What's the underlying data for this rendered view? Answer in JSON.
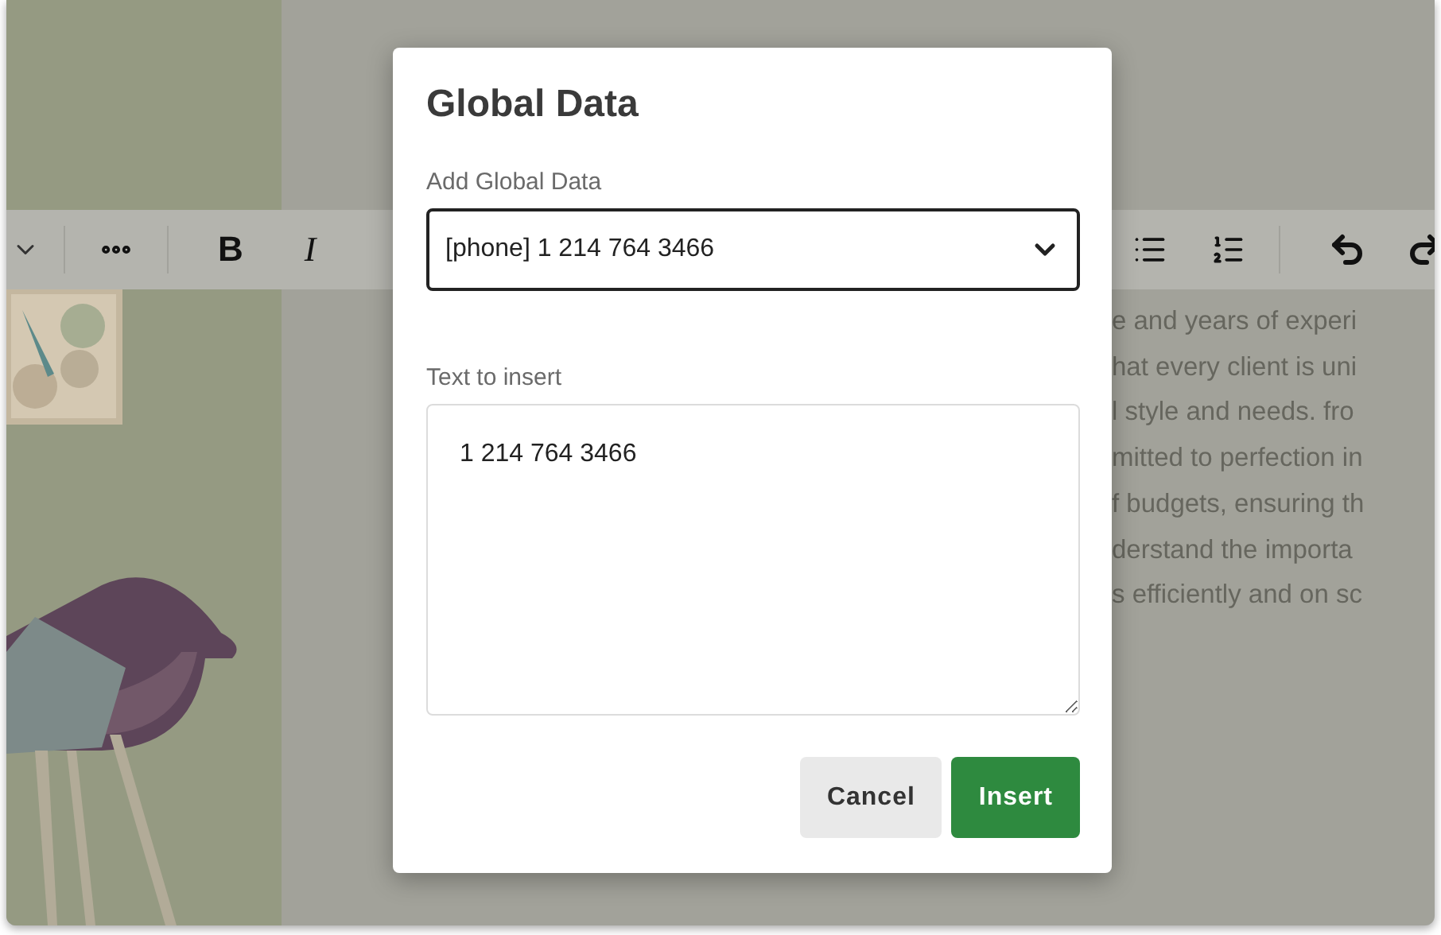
{
  "background": {
    "format_buttons": [
      {
        "label": "B",
        "kind": "bold"
      },
      {
        "label": "I",
        "kind": "italic"
      }
    ],
    "text_lines": [
      "e and years of experi",
      "hat every client is uni",
      "l style and needs. fro",
      "mitted to perfection in",
      "f budgets, ensuring th",
      "derstand the importa",
      "s efficiently and on sc"
    ]
  },
  "dialog": {
    "title": "Global Data",
    "select": {
      "label": "Add Global Data",
      "value": "[phone] 1 214 764 3466"
    },
    "textarea": {
      "label": "Text to insert",
      "value": "1 214 764 3466"
    },
    "buttons": [
      {
        "label": "Cancel",
        "kind": "secondary"
      },
      {
        "label": "Insert",
        "kind": "primary"
      }
    ]
  }
}
